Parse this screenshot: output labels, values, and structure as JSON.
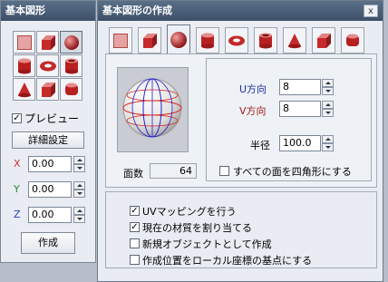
{
  "palette": {
    "title": "基本図形",
    "shapes": [
      "plane",
      "cube",
      "sphere",
      "cylinder",
      "torus",
      "pipe",
      "cone",
      "octahedron",
      "capsule"
    ],
    "preview_label": "プレビュー",
    "preview_checked": true,
    "detail_button": "詳細設定",
    "x_label": "X",
    "x_value": "0.00",
    "y_label": "Y",
    "y_value": "0.00",
    "z_label": "Z",
    "z_value": "0.00",
    "create_button": "作成",
    "colors": {
      "x": "#d03030",
      "y": "#2a8a2a",
      "z": "#2040c0"
    }
  },
  "dialog": {
    "title": "基本図形の作成",
    "close_glyph": "x",
    "tabs": [
      "plane",
      "cube",
      "sphere",
      "cylinder",
      "torus",
      "pipe",
      "cone",
      "octahedron",
      "capsule"
    ],
    "selected_tab": "sphere",
    "u_label": "U方向",
    "u_value": "8",
    "v_label": "V方向",
    "v_value": "8",
    "radius_label": "半径",
    "radius_value": "100.0",
    "faces_label": "面数",
    "faces_value": "64",
    "all_quads_label": "すべての面を四角形にする",
    "all_quads_checked": false,
    "options": [
      {
        "label": "UVマッピングを行う",
        "checked": true
      },
      {
        "label": "現在の材質を割り当てる",
        "checked": true
      },
      {
        "label": "新規オブジェクトとして作成",
        "checked": false
      },
      {
        "label": "作成位置をローカル座標の基点にする",
        "checked": false
      }
    ],
    "colors": {
      "u": "#1a2fa0",
      "v": "#a01a1a"
    }
  }
}
